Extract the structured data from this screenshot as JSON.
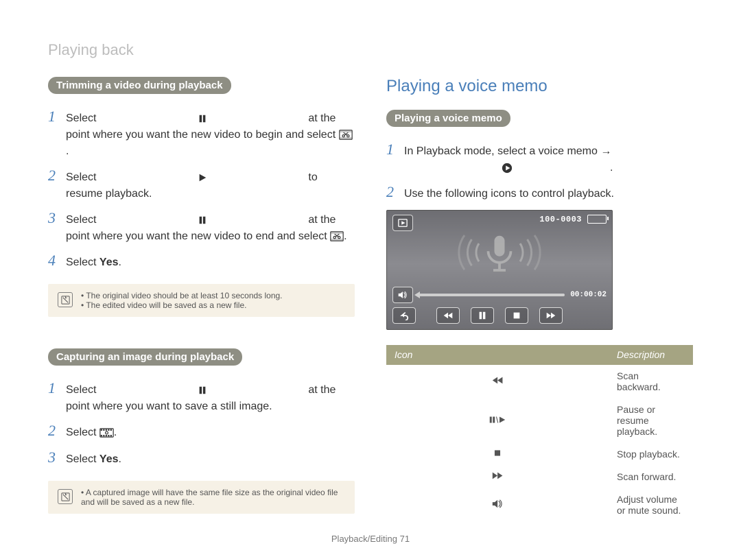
{
  "breadcrumb": "Playing back",
  "left": {
    "section1": {
      "pill": "Trimming a video during playback",
      "steps": [
        {
          "n": "1",
          "pre": "Select ",
          "icon": "pause",
          "post": " at the point where you want the new video to begin and select ",
          "icon2": "film-scissors",
          "post2": "."
        },
        {
          "n": "2",
          "pre": "Select ",
          "icon": "play",
          "post": " to resume playback."
        },
        {
          "n": "3",
          "pre": "Select ",
          "icon": "pause",
          "post": " at the point where you want the new video to end and select ",
          "icon2": "film-scissors",
          "post2": "."
        },
        {
          "n": "4",
          "pre": "Select ",
          "bold": "Yes",
          "post": "."
        }
      ],
      "notes": [
        "The original video should be at least 10 seconds long.",
        "The edited video will be saved as a new file."
      ]
    },
    "section2": {
      "pill": "Capturing an image during playback",
      "steps": [
        {
          "n": "1",
          "pre": "Select ",
          "icon": "pause",
          "post": " at the point where you want to save a still image."
        },
        {
          "n": "2",
          "pre": "Select ",
          "icon": "film-capture",
          "post": "."
        },
        {
          "n": "3",
          "pre": "Select ",
          "bold": "Yes",
          "post": "."
        }
      ],
      "notes": [
        "A captured image will have the same file size as the original video file and will be saved as a new file."
      ]
    }
  },
  "right": {
    "title": "Playing a voice memo",
    "pill": "Playing a voice memo",
    "steps": [
      {
        "n": "1",
        "pre": "In Playback mode, select a voice memo → ",
        "icon": "audio-play-circle",
        "post": "."
      },
      {
        "n": "2",
        "pre": "Use the following icons to control playback."
      }
    ],
    "screenshot": {
      "file_counter": "100-0003",
      "time": "00:00:02"
    },
    "table": {
      "headers": {
        "icon": "Icon",
        "desc": "Description"
      },
      "rows": [
        {
          "icon": "rewind",
          "desc": "Scan backward."
        },
        {
          "icon": "pause-play",
          "desc": "Pause or resume playback."
        },
        {
          "icon": "stop",
          "desc": "Stop playback."
        },
        {
          "icon": "forward",
          "desc": "Scan forward."
        },
        {
          "icon": "volume",
          "desc": "Adjust volume or mute sound."
        }
      ]
    }
  },
  "footer": {
    "label": "Playback/Editing",
    "page": "71"
  }
}
